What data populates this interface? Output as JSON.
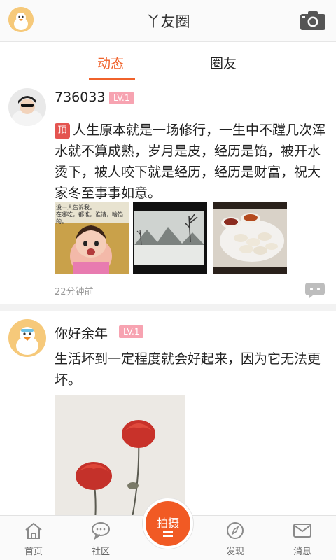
{
  "header": {
    "title": "丫友圈",
    "avatar_icon": "duck-avatar-icon",
    "camera_icon": "camera-icon"
  },
  "tabs": [
    {
      "label": "动态",
      "active": true
    },
    {
      "label": "圈友",
      "active": false
    }
  ],
  "posts": [
    {
      "username": "736033",
      "level": "LV.1",
      "top_badge": "顶",
      "text": "人生原本就是一场修行，一生中不蹚几次浑水就不算成熟，岁月是皮，经历是馅，被开水烫下，被人咬下就是经历，经历是财富，祝大家冬至事事如意。",
      "image_caption": "没一人告诉我。\n在哪吃，都谁，谁请，啥馅的。",
      "timestamp": "22分钟前",
      "comment_icon": "comment-icon"
    },
    {
      "username": "你好余年",
      "level": "LV.1",
      "text": "生活坏到一定程度就会好起来，因为它无法更坏。"
    }
  ],
  "bottom_nav": {
    "items": [
      {
        "label": "首页",
        "icon": "home-icon"
      },
      {
        "label": "社区",
        "icon": "chat-bubble-icon"
      },
      {
        "label": "发现",
        "icon": "compass-icon"
      },
      {
        "label": "消息",
        "icon": "mail-icon"
      }
    ],
    "center_button": {
      "label": "拍摄"
    }
  },
  "colors": {
    "accent": "#f0622b",
    "level_badge": "#f7a3b1",
    "top_badge": "#e45450"
  }
}
